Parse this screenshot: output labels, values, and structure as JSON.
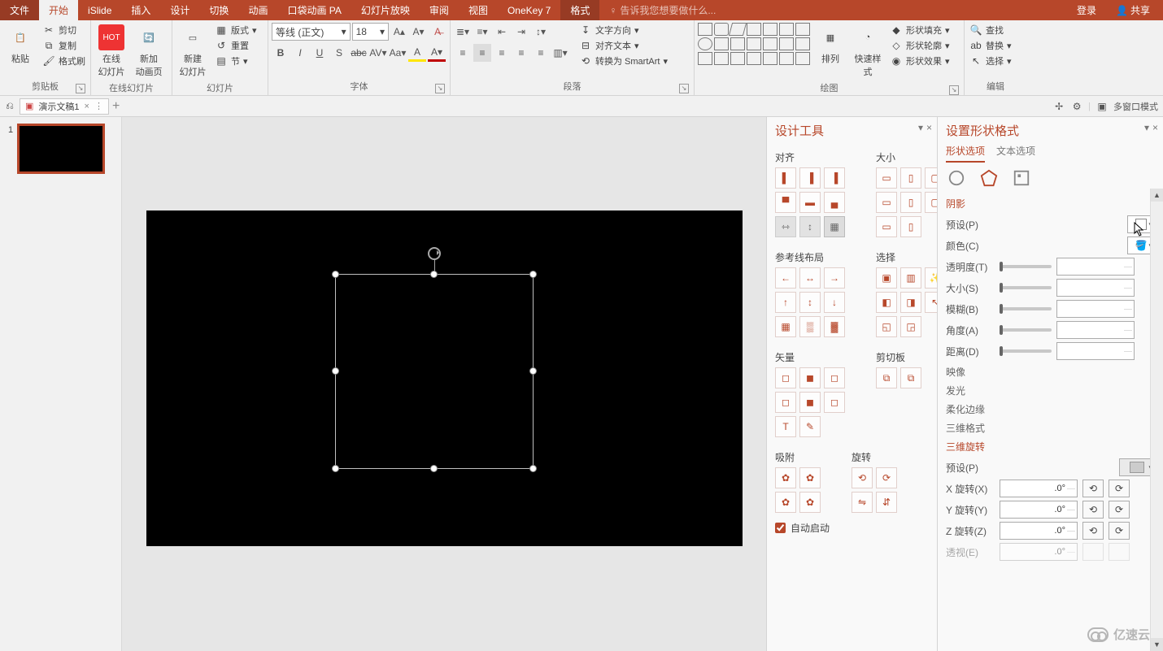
{
  "titlebar": {
    "tabs": [
      "文件",
      "开始",
      "iSlide",
      "插入",
      "设计",
      "切换",
      "动画",
      "口袋动画 PA",
      "幻灯片放映",
      "审阅",
      "视图",
      "OneKey 7",
      "格式"
    ],
    "tellme": "告诉我您想要做什么...",
    "login": "登录",
    "share": "共享"
  },
  "ribbon": {
    "clipboard": {
      "label": "剪贴板",
      "paste": "粘贴",
      "cut": "剪切",
      "copy": "复制",
      "formatPainter": "格式刷"
    },
    "onlineSlides": {
      "label": "在线幻灯片",
      "onlineSlide": "在线\n幻灯片",
      "newAnim": "新加\n动画页"
    },
    "slides": {
      "label": "幻灯片",
      "newSlide": "新建\n幻灯片",
      "layout": "版式",
      "reset": "重置",
      "section": "节"
    },
    "font": {
      "label": "字体",
      "name": "等线 (正文)",
      "size": "18"
    },
    "paragraph": {
      "label": "段落",
      "textdir": "文字方向",
      "align": "对齐文本",
      "smartart": "转换为 SmartArt"
    },
    "drawing": {
      "label": "绘图",
      "arrange": "排列",
      "quickstyle": "快速样式",
      "fill": "形状填充",
      "outline": "形状轮廓",
      "effects": "形状效果"
    },
    "editing": {
      "label": "编辑",
      "find": "查找",
      "replace": "替换",
      "select": "选择"
    }
  },
  "docstrip": {
    "docname": "演示文稿1",
    "multiwin": "多窗口模式"
  },
  "thumb": {
    "num": "1"
  },
  "designPane": {
    "title": "设计工具",
    "sections": {
      "align": "对齐",
      "size": "大小",
      "guides": "参考线布局",
      "select": "选择",
      "vector": "矢量",
      "clipboard": "剪切板",
      "snap": "吸附",
      "rotate": "旋转"
    },
    "autostart": "自动启动"
  },
  "formatPane": {
    "title": "设置形状格式",
    "tabs": {
      "shape": "形状选项",
      "text": "文本选项"
    },
    "shadow": "阴影",
    "preset": "预设(P)",
    "color": "颜色(C)",
    "transparency": "透明度(T)",
    "sizeL": "大小(S)",
    "blur": "模糊(B)",
    "angle": "角度(A)",
    "distance": "距离(D)",
    "reflection": "映像",
    "glow": "发光",
    "softedge": "柔化边缘",
    "format3d": "三维格式",
    "rotate3d": "三维旋转",
    "preset2": "预设(P)",
    "xrot": "X 旋转(X)",
    "yrot": "Y 旋转(Y)",
    "zrot": "Z 旋转(Z)",
    "persp": "透视(E)",
    "deg": ".0°"
  },
  "watermark": "亿速云"
}
